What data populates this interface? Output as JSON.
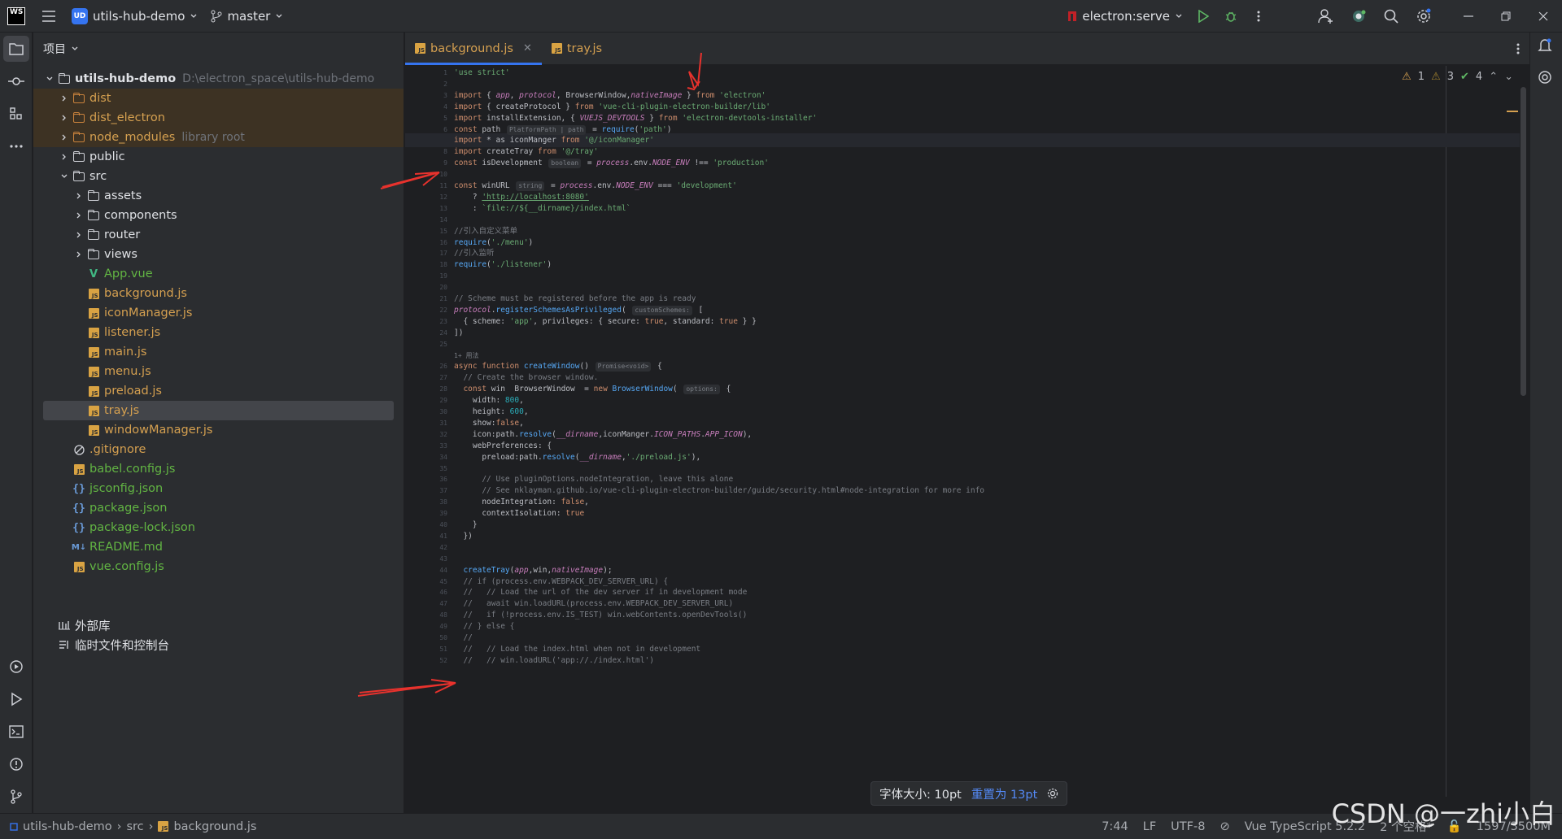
{
  "titlebar": {
    "logo_text": "WS",
    "project_badge": "UD",
    "project_name": "utils-hub-demo",
    "branch": "master",
    "run_config": "electron:serve"
  },
  "project_panel": {
    "header": "项目",
    "root_name": "utils-hub-demo",
    "root_path": "D:\\electron_space\\utils-hub-demo",
    "items": [
      {
        "label": "dist",
        "hint": "",
        "kind": "folder-orange",
        "depth": 1,
        "chevron": "right",
        "color": "orange",
        "highlight": true
      },
      {
        "label": "dist_electron",
        "hint": "",
        "kind": "folder-orange",
        "depth": 1,
        "chevron": "right",
        "color": "orange",
        "highlight": true
      },
      {
        "label": "node_modules",
        "hint": "library root",
        "kind": "folder-orange",
        "depth": 1,
        "chevron": "right",
        "color": "orange",
        "highlight": true
      },
      {
        "label": "public",
        "hint": "",
        "kind": "folder",
        "depth": 1,
        "chevron": "right",
        "color": "white"
      },
      {
        "label": "src",
        "hint": "",
        "kind": "folder",
        "depth": 1,
        "chevron": "down",
        "color": "white"
      },
      {
        "label": "assets",
        "hint": "",
        "kind": "folder",
        "depth": 2,
        "chevron": "right",
        "color": "white"
      },
      {
        "label": "components",
        "hint": "",
        "kind": "folder",
        "depth": 2,
        "chevron": "right",
        "color": "white"
      },
      {
        "label": "router",
        "hint": "",
        "kind": "folder",
        "depth": 2,
        "chevron": "right",
        "color": "white"
      },
      {
        "label": "views",
        "hint": "",
        "kind": "folder",
        "depth": 2,
        "chevron": "right",
        "color": "white"
      },
      {
        "label": "App.vue",
        "hint": "",
        "kind": "vue",
        "depth": 2,
        "chevron": "",
        "color": "green"
      },
      {
        "label": "background.js",
        "hint": "",
        "kind": "js",
        "depth": 2,
        "chevron": "",
        "color": "orange"
      },
      {
        "label": "iconManager.js",
        "hint": "",
        "kind": "js",
        "depth": 2,
        "chevron": "",
        "color": "orange"
      },
      {
        "label": "listener.js",
        "hint": "",
        "kind": "js",
        "depth": 2,
        "chevron": "",
        "color": "orange"
      },
      {
        "label": "main.js",
        "hint": "",
        "kind": "js",
        "depth": 2,
        "chevron": "",
        "color": "orange"
      },
      {
        "label": "menu.js",
        "hint": "",
        "kind": "js",
        "depth": 2,
        "chevron": "",
        "color": "orange"
      },
      {
        "label": "preload.js",
        "hint": "",
        "kind": "js",
        "depth": 2,
        "chevron": "",
        "color": "orange"
      },
      {
        "label": "tray.js",
        "hint": "",
        "kind": "js",
        "depth": 2,
        "chevron": "",
        "color": "orange",
        "selected": true
      },
      {
        "label": "windowManager.js",
        "hint": "",
        "kind": "js",
        "depth": 2,
        "chevron": "",
        "color": "orange"
      },
      {
        "label": ".gitignore",
        "hint": "",
        "kind": "ignore",
        "depth": 1,
        "chevron": "",
        "color": "orange"
      },
      {
        "label": "babel.config.js",
        "hint": "",
        "kind": "js",
        "depth": 1,
        "chevron": "",
        "color": "green"
      },
      {
        "label": "jsconfig.json",
        "hint": "",
        "kind": "json",
        "depth": 1,
        "chevron": "",
        "color": "green"
      },
      {
        "label": "package.json",
        "hint": "",
        "kind": "json",
        "depth": 1,
        "chevron": "",
        "color": "green"
      },
      {
        "label": "package-lock.json",
        "hint": "",
        "kind": "json",
        "depth": 1,
        "chevron": "",
        "color": "green"
      },
      {
        "label": "README.md",
        "hint": "",
        "kind": "md",
        "depth": 1,
        "chevron": "",
        "color": "green"
      },
      {
        "label": "vue.config.js",
        "hint": "",
        "kind": "js",
        "depth": 1,
        "chevron": "",
        "color": "green"
      }
    ],
    "external_libs": "外部库",
    "scratches": "临时文件和控制台"
  },
  "tabs": [
    {
      "label": "background.js",
      "active": true
    },
    {
      "label": "tray.js",
      "active": false
    }
  ],
  "inspections": {
    "warnings": "1",
    "weak_warnings": "3",
    "ok": "4"
  },
  "code": {
    "current_line": 7,
    "lines": [
      "'use strict'",
      "",
      "import { app, protocol, BrowserWindow,nativeImage } from 'electron'",
      "import { createProtocol } from 'vue-cli-plugin-electron-builder/lib'",
      "import installExtension, { VUEJS_DEVTOOLS } from 'electron-devtools-installer'",
      "const path  PlatformPath | path  = require('path')",
      "import * as iconManger from '@/iconManager'",
      "import createTray from '@/tray'",
      "const isDevelopment  boolean  = process.env.NODE_ENV !== 'production'",
      "",
      "const winURL  string  = process.env.NODE_ENV === 'development'",
      "    ? 'http://localhost:8080'",
      "    : `file://${__dirname}/index.html`",
      "",
      "//引入自定义菜单",
      "require('./menu')",
      "//引入监听",
      "require('./listener')",
      "",
      "",
      "// Scheme must be registered before the app is ready",
      "protocol.registerSchemesAsPrivileged( customSchemes: [",
      "  { scheme: 'app', privileges: { secure: true, standard: true } }",
      "])",
      "",
      "async function createWindow()  Promise<void>  {",
      "  // Create the browser window.",
      "  const win  BrowserWindow  = new BrowserWindow( options: {",
      "    width: 800,",
      "    height: 600,",
      "    show:false,",
      "    icon:path.resolve(__dirname,iconManger.ICON_PATHS.APP_ICON),",
      "    webPreferences: {",
      "      preload:path.resolve(__dirname,'./preload.js'),",
      "",
      "      // Use pluginOptions.nodeIntegration, leave this alone",
      "      // See nklayman.github.io/vue-cli-plugin-electron-builder/guide/security.html#node-integration for more info",
      "      nodeIntegration: false,",
      "      contextIsolation: true",
      "    }",
      "  })",
      "",
      "",
      "  createTray(app,win,nativeImage);",
      "  // if (process.env.WEBPACK_DEV_SERVER_URL) {",
      "  //   // Load the url of the dev server if in development mode",
      "  //   await win.loadURL(process.env.WEBPACK_DEV_SERVER_URL)",
      "  //   if (!process.env.IS_TEST) win.webContents.openDevTools()",
      "  // } else {",
      "  //",
      "  //   // Load the index.html when not in development",
      "  //   // win.loadURL('app://./index.html')"
    ],
    "usages_hint": "1+ 用法"
  },
  "font_popup": {
    "text": "字体大小: 10pt",
    "reset_link": "重置为 13pt"
  },
  "statusbar": {
    "crumbs": [
      "utils-hub-demo",
      "src",
      "background.js"
    ],
    "position": "7:44",
    "line_sep": "LF",
    "encoding": "UTF-8",
    "language": "Vue TypeScript 5.2.2",
    "indent": "2 个空格*",
    "memory": "1597/3500M"
  },
  "watermark": "CSDN @一zhi小白",
  "colors": {
    "accent": "#3574f0",
    "arrow": "#e8322d",
    "ignored_folder": "#3d3223"
  }
}
